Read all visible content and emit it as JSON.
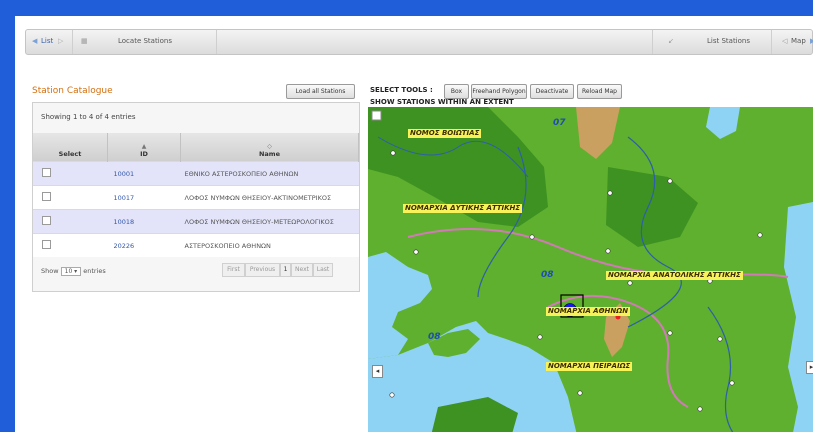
{
  "toolbar": {
    "list": "List",
    "locate": "Locate Stations",
    "list_stations": "List Stations",
    "map": "Map"
  },
  "catalogue": {
    "title": "Station Catalogue",
    "load_all_label": "Load all Stations",
    "showing": "Showing 1 to 4 of 4 entries",
    "columns": {
      "select": "Select",
      "id": "ID",
      "name": "Name"
    },
    "rows": [
      {
        "id": "10001",
        "name": "ΕΘΝΙΚΟ ΑΣΤΕΡΟΣΚΟΠΕΙΟ ΑΘΗΝΩΝ"
      },
      {
        "id": "10017",
        "name": "ΛΟΦΟΣ ΝΥΜΦΩΝ ΘΗΣΕΙΟΥ-ΑΚΤΙΝΟΜΕΤΡΙΚΟΣ"
      },
      {
        "id": "10018",
        "name": "ΛΟΦΟΣ ΝΥΜΦΩΝ ΘΗΣΕΙΟΥ-ΜΕΤΕΩΡΟΛΟΓΙΚΟΣ"
      },
      {
        "id": "20226",
        "name": "ΑΣΤΕΡΟΣΚΟΠΕΙΟ ΑΘΗΝΩΝ"
      }
    ],
    "show_label": "Show",
    "entries_value": "10",
    "entries_label": "entries",
    "pager": {
      "first": "First",
      "previous": "Previous",
      "page": "1",
      "next": "Next",
      "last": "Last"
    }
  },
  "select_tools": {
    "label": "SELECT TOOLS :",
    "box": "Box",
    "polygon": "Freehand Polygon",
    "deactivate": "Deactivate",
    "reload": "Reload Map",
    "subtitle": "SHOW STATIONS WITHIN AN EXTENT"
  },
  "map": {
    "labels": {
      "boiotia": "ΝΟΜΟΣ ΒΟΙΩΤΙΑΣ",
      "dytikis": "ΝΟΜΑΡΧΙΑ ΔΥΤΙΚΗΣ ΑΤΤΙΚΗΣ",
      "anatolikis": "ΝΟΜΑΡΧΙΑ ΑΝΑΤΟΛΙΚΗΣ ΑΤΤΙΚΗΣ",
      "athinon": "ΝΟΜΑΡΧΙΑ ΑΘΗΝΩΝ",
      "peiraios": "ΝΟΜΑΡΧΙΑ ΠΕΙΡΑΙΩΣ"
    },
    "shields": {
      "a": "07",
      "b": "08",
      "c": "08"
    },
    "colors": {
      "sea": "#8fd3f4",
      "land": "#5fb02e",
      "highland": "#3e9222",
      "mountain": "#c9a060",
      "river": "#2d5fa8",
      "marker": "#1a1ae8",
      "frame": "#1f5ed8"
    }
  }
}
